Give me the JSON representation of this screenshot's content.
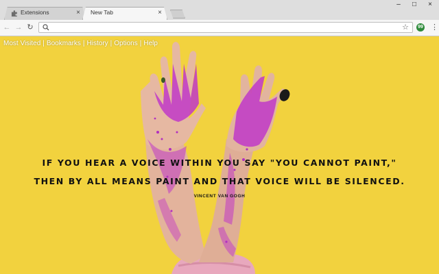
{
  "tabs": [
    {
      "title": "Extensions",
      "active": false,
      "icon": "puzzle-icon"
    },
    {
      "title": "New Tab",
      "active": true
    }
  ],
  "window_controls": {
    "minimize": "–",
    "maximize": "□",
    "close": "×"
  },
  "toolbar": {
    "omnibox_value": "",
    "star": "☆",
    "extension_label": "99"
  },
  "page": {
    "nav_links": [
      "Most Visited",
      "Bookmarks",
      "History",
      "Options",
      "Help"
    ],
    "separator": "|",
    "quote_line1": "IF YOU HEAR A VOICE WITHIN YOU SAY \"YOU CANNOT PAINT,\"",
    "quote_line2": "THEN BY ALL MEANS PAINT AND THAT VOICE WILL BE SILENCED.",
    "author": "VINCENT VAN GOGH"
  },
  "colors": {
    "background_yellow": "#f2d23e",
    "glitter_pink": "#c038c8",
    "skin": "#e6b8a2",
    "sweater_pink": "#e8a8bd"
  }
}
